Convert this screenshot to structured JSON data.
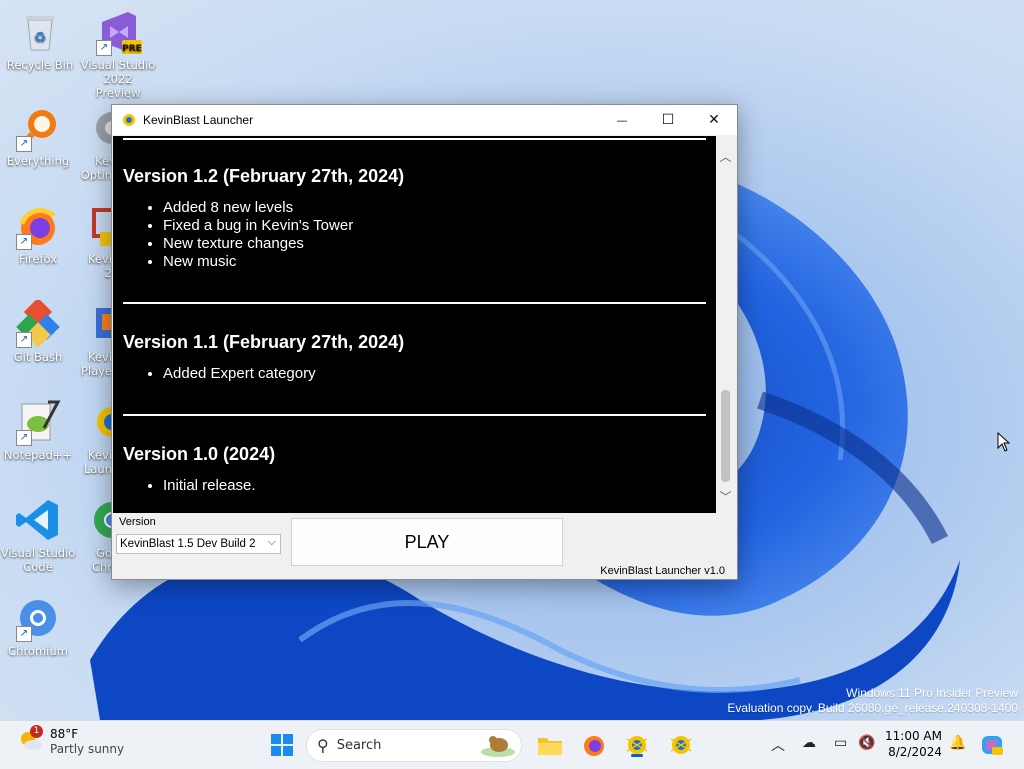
{
  "desktop": {
    "icons": [
      {
        "label": "Recycle Bin"
      },
      {
        "label": "Visual Studio 2022 Preview",
        "badge": "PRE"
      },
      {
        "label": "Everything"
      },
      {
        "label": "Kev Optim"
      },
      {
        "label": "Firefox"
      },
      {
        "label": "Kevi 2"
      },
      {
        "label": "Git Bash"
      },
      {
        "label": "Kevi Playe"
      },
      {
        "label": "Notepad++"
      },
      {
        "label": "Kevi Laun"
      },
      {
        "label": "Visual Studio Code"
      },
      {
        "label": "Go Chr"
      },
      {
        "label": "Chromium"
      }
    ],
    "watermark": {
      "line1": "Windows 11 Pro Insider Preview",
      "line2": "Evaluation copy. Build 26080.ge_release.240308-1400"
    }
  },
  "window": {
    "title": "KevinBlast Launcher",
    "controls": {
      "minimize": "—",
      "maximize": "☐",
      "close": "✕"
    },
    "changelog": [
      {
        "heading": "Version 1.2 (February 27th, 2024)",
        "items": [
          "Added 8 new levels",
          "Fixed a bug in Kevin's Tower",
          "New texture changes",
          "New music"
        ]
      },
      {
        "heading": "Version 1.1 (February 27th, 2024)",
        "items": [
          "Added Expert category"
        ]
      },
      {
        "heading": "Version 1.0 (2024)",
        "items": [
          "Initial release."
        ]
      }
    ],
    "version_label": "Version",
    "version_selected": "KevinBlast 1.5 Dev Build 2",
    "play_label": "PLAY",
    "launcher_version": "KevinBlast Launcher v1.0"
  },
  "taskbar": {
    "weather": {
      "badge": "1",
      "temp": "88°F",
      "condition": "Partly sunny"
    },
    "search_placeholder": "Search",
    "clock": {
      "time": "11:00 AM",
      "date": "8/2/2024"
    }
  },
  "colors": {
    "accent": "#0067c0",
    "changelog_bg": "#000000",
    "changelog_text": "#ffffff"
  }
}
